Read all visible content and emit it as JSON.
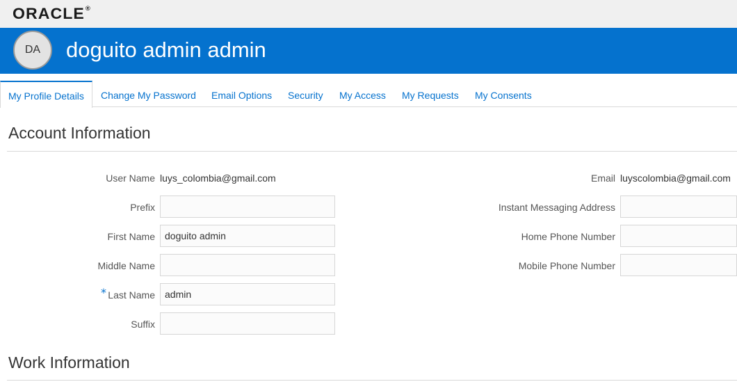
{
  "brand": {
    "logo_text": "ORACLE",
    "reg_mark": "®"
  },
  "header": {
    "avatar_initials": "DA",
    "user_display_name": "doguito admin admin"
  },
  "tabs": [
    {
      "label": "My Profile Details",
      "active": true
    },
    {
      "label": "Change My Password",
      "active": false
    },
    {
      "label": "Email Options",
      "active": false
    },
    {
      "label": "Security",
      "active": false
    },
    {
      "label": "My Access",
      "active": false
    },
    {
      "label": "My Requests",
      "active": false
    },
    {
      "label": "My Consents",
      "active": false
    }
  ],
  "account": {
    "title": "Account Information",
    "user_name_label": "User Name",
    "user_name_value": "luys_colombia@gmail.com",
    "prefix_label": "Prefix",
    "prefix_value": "",
    "first_name_label": "First Name",
    "first_name_value": "doguito admin",
    "middle_name_label": "Middle Name",
    "middle_name_value": "",
    "last_name_label": "Last Name",
    "last_name_value": "admin",
    "required_mark": "*",
    "suffix_label": "Suffix",
    "suffix_value": "",
    "email_label": "Email",
    "email_value": "luyscolombia@gmail.com",
    "im_label": "Instant Messaging Address",
    "im_value": "",
    "home_phone_label": "Home Phone Number",
    "home_phone_value": "",
    "mobile_phone_label": "Mobile Phone Number",
    "mobile_phone_value": ""
  },
  "work": {
    "title": "Work Information"
  },
  "colors": {
    "brand_blue": "#0572ce",
    "topbar_gray": "#f0f0f0"
  }
}
